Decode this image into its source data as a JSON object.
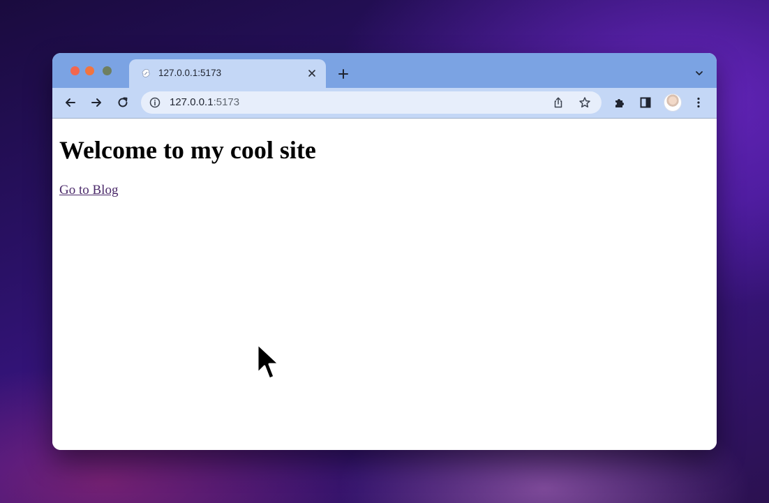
{
  "browser": {
    "tab": {
      "title": "127.0.0.1:5173",
      "favicon": "svelte-icon"
    },
    "address_bar": {
      "host": "127.0.0.1",
      "port": ":5173"
    },
    "colors": {
      "tabstrip": "#7ba3e3",
      "toolbar": "#c4d7f6",
      "omnibox": "#e7eefb"
    }
  },
  "page": {
    "heading": "Welcome to my cool site",
    "link": "Go to Blog"
  }
}
